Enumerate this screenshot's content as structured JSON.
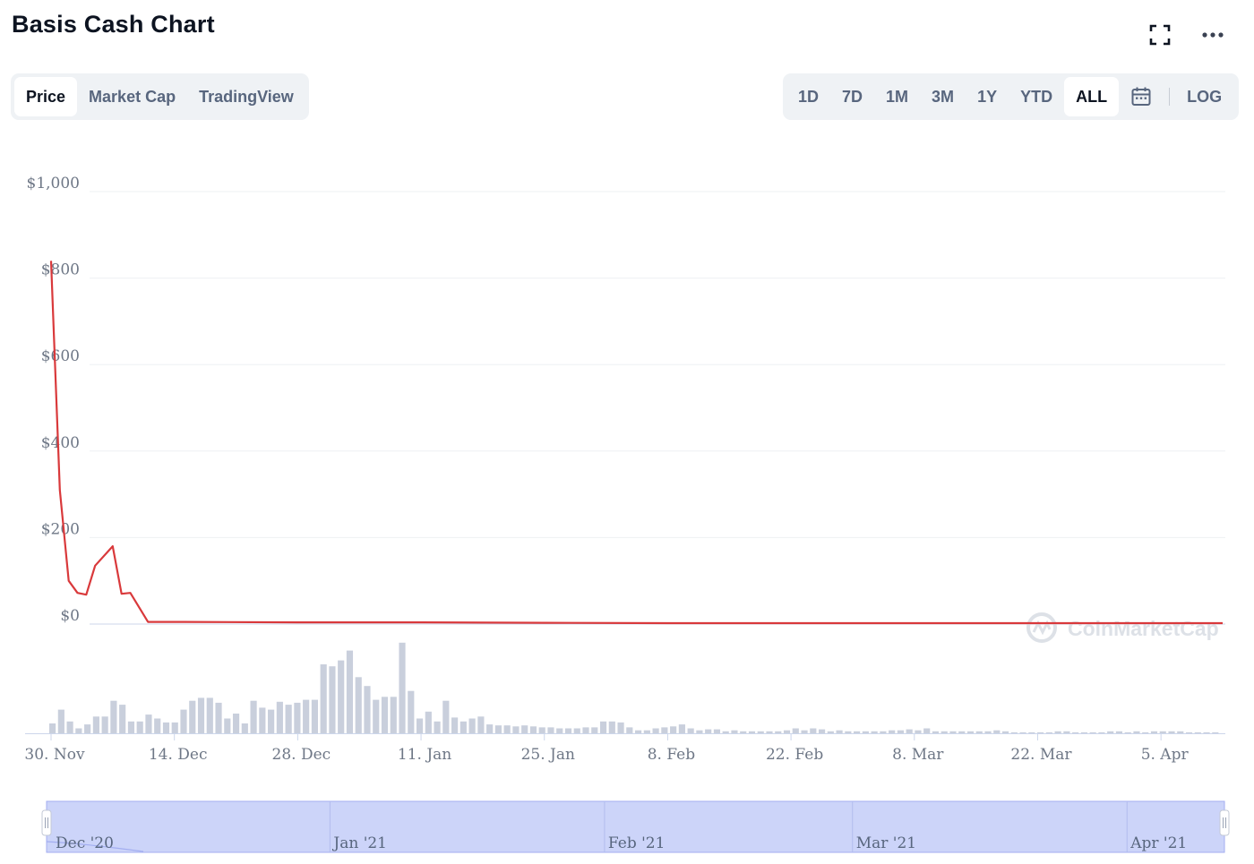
{
  "header": {
    "title": "Basis Cash Chart"
  },
  "tabs": [
    {
      "label": "Price",
      "active": true
    },
    {
      "label": "Market Cap",
      "active": false
    },
    {
      "label": "TradingView",
      "active": false
    }
  ],
  "ranges": [
    {
      "label": "1D",
      "active": false
    },
    {
      "label": "7D",
      "active": false
    },
    {
      "label": "1M",
      "active": false
    },
    {
      "label": "3M",
      "active": false
    },
    {
      "label": "1Y",
      "active": false
    },
    {
      "label": "YTD",
      "active": false
    },
    {
      "label": "ALL",
      "active": true
    }
  ],
  "log_label": "LOG",
  "icons": {
    "fullscreen": "fullscreen-icon",
    "more": "more-icon",
    "calendar": "calendar-icon"
  },
  "colors": {
    "price_line": "#d9393b",
    "volume_bar": "#c9cfdc",
    "navigator_fill": "#ccd4f9",
    "navigator_edge": "#a3aef0"
  },
  "watermark": "CoinMarketCap",
  "chart_data": {
    "type": "line",
    "title": "",
    "x_range": [
      "2020-11-30",
      "2021-04-12"
    ],
    "x_tick_labels": [
      "30. Nov",
      "14. Dec",
      "28. Dec",
      "11. Jan",
      "25. Jan",
      "8. Feb",
      "22. Feb",
      "8. Mar",
      "22. Mar",
      "5. Apr"
    ],
    "y_tick_labels": [
      "$0",
      "$200",
      "$400",
      "$600",
      "$800",
      "$1,000"
    ],
    "ylim": [
      0,
      1000
    ],
    "grid": true,
    "price_series": {
      "name": "",
      "points": [
        [
          "2020-11-30",
          840
        ],
        [
          "2020-12-01",
          310
        ],
        [
          "2020-12-02",
          100
        ],
        [
          "2020-12-03",
          72
        ],
        [
          "2020-12-04",
          68
        ],
        [
          "2020-12-05",
          135
        ],
        [
          "2020-12-07",
          180
        ],
        [
          "2020-12-08",
          70
        ],
        [
          "2020-12-09",
          72
        ],
        [
          "2020-12-11",
          5
        ],
        [
          "2020-12-15",
          5
        ],
        [
          "2020-12-28",
          4
        ],
        [
          "2021-01-11",
          4
        ],
        [
          "2021-01-25",
          3
        ],
        [
          "2021-02-08",
          2
        ],
        [
          "2021-02-22",
          2
        ],
        [
          "2021-03-08",
          2
        ],
        [
          "2021-03-22",
          2
        ],
        [
          "2021-04-05",
          2
        ],
        [
          "2021-04-12",
          2
        ]
      ]
    },
    "volume_series": {
      "name": "",
      "relative_values": [
        0.1,
        0.24,
        0.12,
        0.05,
        0.09,
        0.17,
        0.17,
        0.33,
        0.29,
        0.12,
        0.12,
        0.19,
        0.15,
        0.11,
        0.11,
        0.24,
        0.33,
        0.36,
        0.36,
        0.31,
        0.15,
        0.2,
        0.1,
        0.33,
        0.26,
        0.24,
        0.32,
        0.29,
        0.31,
        0.34,
        0.34,
        0.7,
        0.68,
        0.74,
        0.84,
        0.57,
        0.48,
        0.34,
        0.37,
        0.37,
        0.92,
        0.43,
        0.15,
        0.22,
        0.12,
        0.33,
        0.16,
        0.12,
        0.15,
        0.17,
        0.09,
        0.08,
        0.08,
        0.07,
        0.08,
        0.07,
        0.06,
        0.06,
        0.05,
        0.05,
        0.05,
        0.06,
        0.06,
        0.12,
        0.12,
        0.11,
        0.06,
        0.03,
        0.03,
        0.05,
        0.06,
        0.07,
        0.09,
        0.05,
        0.03,
        0.04,
        0.04,
        0.02,
        0.03,
        0.02,
        0.02,
        0.02,
        0.02,
        0.02,
        0.03,
        0.05,
        0.03,
        0.05,
        0.04,
        0.02,
        0.03,
        0.02,
        0.02,
        0.02,
        0.02,
        0.02,
        0.03,
        0.03,
        0.04,
        0.03,
        0.05,
        0.02,
        0.02,
        0.02,
        0.02,
        0.02,
        0.02,
        0.02,
        0.03,
        0.02,
        0.01,
        0.01,
        0.01,
        0.01,
        0.01,
        0.02,
        0.02,
        0.01,
        0.01,
        0.01,
        0.01,
        0.02,
        0.02,
        0.01,
        0.02,
        0.01,
        0.02,
        0.02,
        0.02,
        0.02,
        0.01,
        0.01,
        0.01,
        0.01
      ]
    },
    "navigator": {
      "labels": [
        "Dec '20",
        "Jan '21",
        "Feb '21",
        "Mar '21",
        "Apr '21"
      ]
    }
  }
}
